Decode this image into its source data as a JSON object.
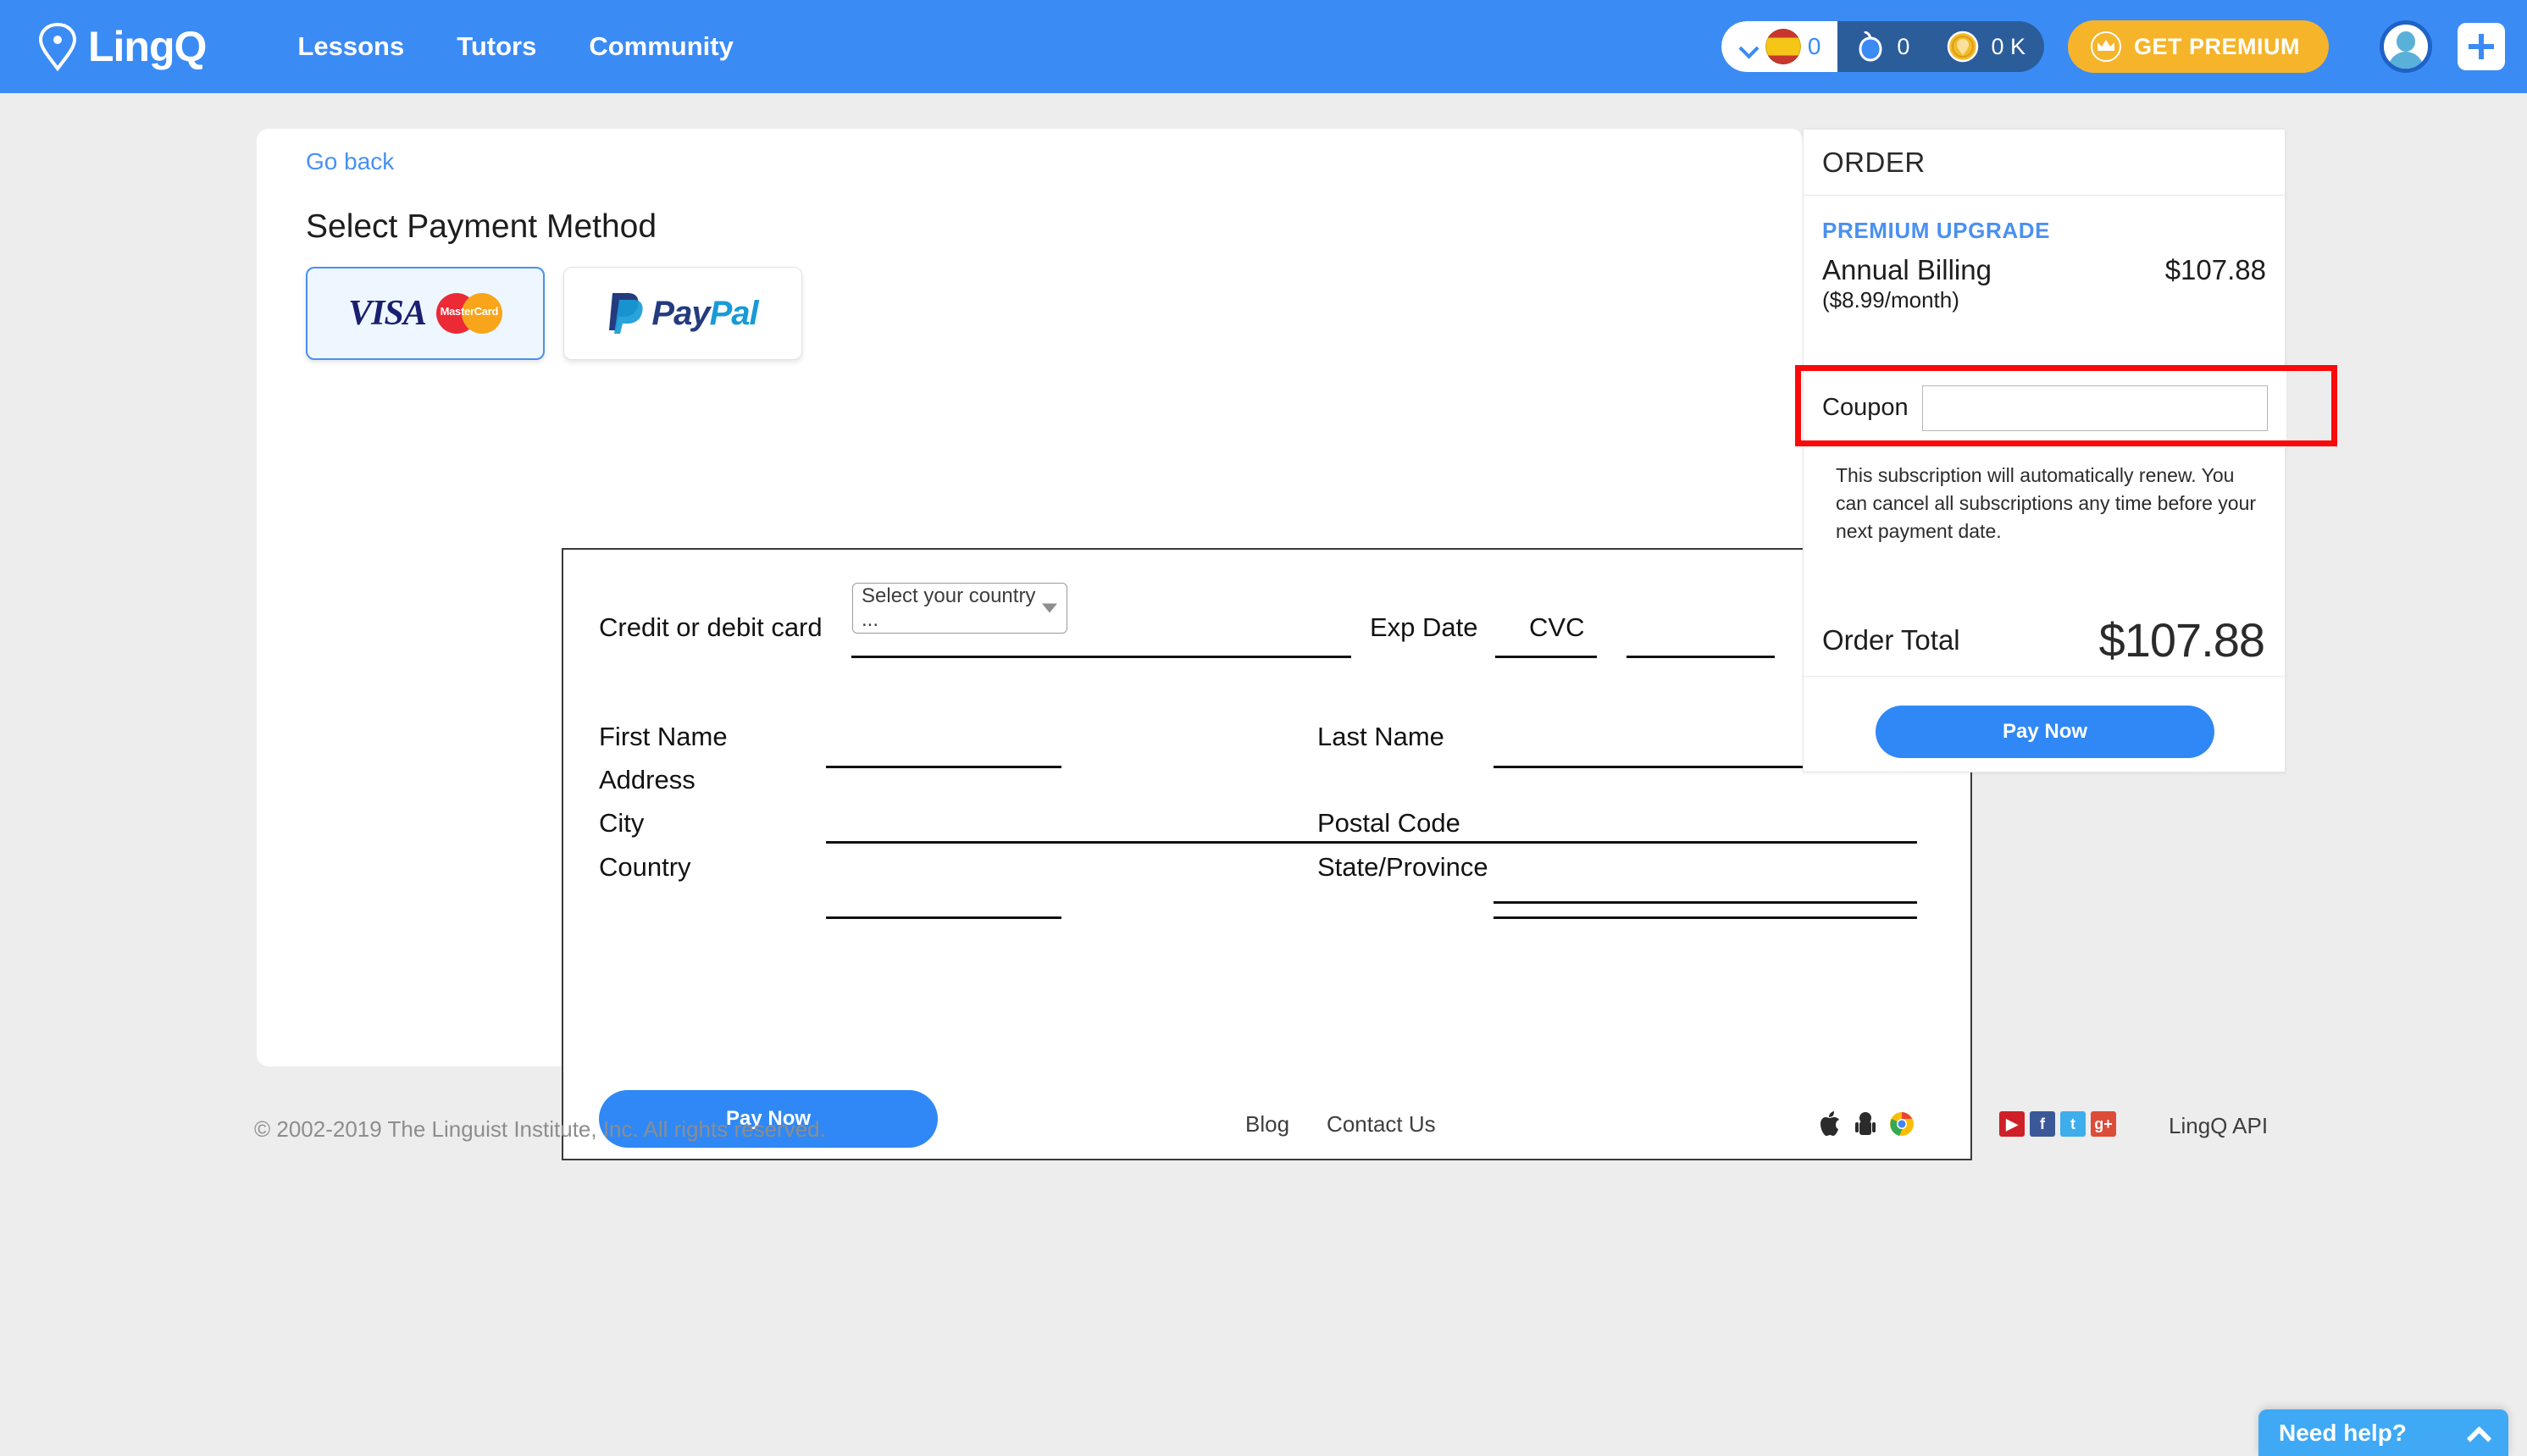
{
  "header": {
    "brand": "LingQ",
    "nav": [
      {
        "label": "Lessons"
      },
      {
        "label": "Tutors"
      },
      {
        "label": "Community"
      }
    ],
    "stats": {
      "language_count": "0",
      "language_flag": "spain-flag-icon",
      "apple_count": "0",
      "coin_count": "0 K"
    },
    "premium_button": "GET PREMIUM",
    "avatar_name": "avatar",
    "add_button": "+"
  },
  "main": {
    "go_back": "Go back",
    "title": "Select Payment Method",
    "methods": [
      {
        "id": "card",
        "visa": "VISA",
        "mastercard": "MasterCard",
        "selected": true
      },
      {
        "id": "paypal",
        "pay": "Pay",
        "pal": "Pal",
        "selected": false
      }
    ],
    "form": {
      "card_label": "Credit or debit card",
      "exp_label": "Exp Date",
      "cvc_label": "CVC",
      "first_name_label": "First Name",
      "last_name_label": "Last Name",
      "address_label": "Address",
      "city_label": "City",
      "postal_label": "Postal Code",
      "country_label": "Country",
      "country_value": "Select your country ...",
      "state_label": "State/Province",
      "pay_button": "Pay Now",
      "card_value": "",
      "exp_value": "",
      "cvc_value": "",
      "first_name_value": "",
      "last_name_value": "",
      "address_value": "",
      "city_value": "",
      "postal_value": "",
      "state_value": ""
    }
  },
  "order": {
    "heading": "ORDER",
    "premium_label": "PREMIUM UPGRADE",
    "billing_name": "Annual Billing",
    "billing_sub": "($8.99/month)",
    "billing_price": "$107.88",
    "coupon_label": "Coupon",
    "coupon_value": "",
    "coupon_placeholder": "",
    "renew_note": "This subscription will automatically renew. You can cancel all subscriptions any time before your next payment date.",
    "total_label": "Order Total",
    "total_amount": "$107.88",
    "pay_button": "Pay Now",
    "highlight_color": "#fa0a0a"
  },
  "footer": {
    "copyright": "© 2002-2019 The Linguist Institute, Inc. All rights reserved.",
    "links": [
      {
        "label": "Blog"
      },
      {
        "label": "Contact Us"
      }
    ],
    "store_icons": [
      "apple-icon",
      "android-icon",
      "chrome-icon"
    ],
    "social_icons": [
      {
        "name": "youtube-icon",
        "glyph": "▶"
      },
      {
        "name": "facebook-icon",
        "glyph": "f"
      },
      {
        "name": "twitter-icon",
        "glyph": "t"
      },
      {
        "name": "googleplus-icon",
        "glyph": "g+"
      }
    ],
    "api_link": "LingQ API"
  },
  "help": {
    "label": "Need help?"
  }
}
